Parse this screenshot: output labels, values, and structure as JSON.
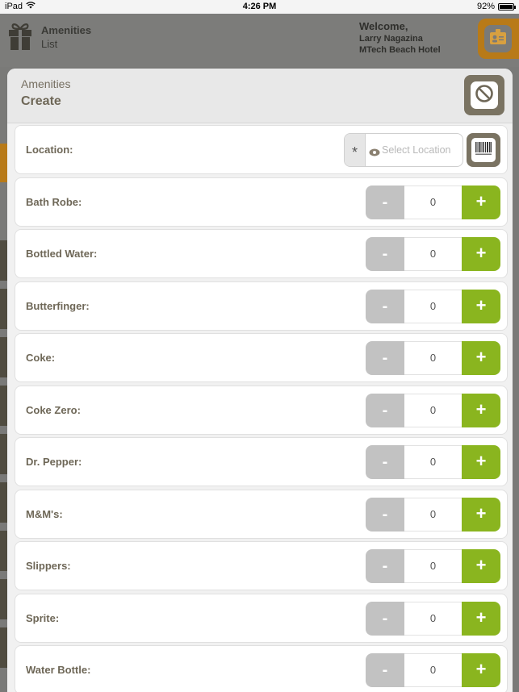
{
  "status": {
    "device": "iPad",
    "time": "4:26 PM",
    "battery": "92%",
    "battery_level": 0.92
  },
  "header": {
    "title": "Amenities",
    "subtitle": "List",
    "welcome": "Welcome,",
    "user": "Larry Nagazina",
    "hotel": "MTech Beach Hotel"
  },
  "modal": {
    "title": "Amenities",
    "subtitle": "Create",
    "location": {
      "label": "Location:",
      "required_mark": "*",
      "placeholder": "Select Location"
    },
    "items": [
      {
        "label": "Bath Robe:",
        "value": "0",
        "minus": "-",
        "plus": "+"
      },
      {
        "label": "Bottled Water:",
        "value": "0",
        "minus": "-",
        "plus": "+"
      },
      {
        "label": "Butterfinger:",
        "value": "0",
        "minus": "-",
        "plus": "+"
      },
      {
        "label": "Coke:",
        "value": "0",
        "minus": "-",
        "plus": "+"
      },
      {
        "label": "Coke Zero:",
        "value": "0",
        "minus": "-",
        "plus": "+"
      },
      {
        "label": "Dr. Pepper:",
        "value": "0",
        "minus": "-",
        "plus": "+"
      },
      {
        "label": "M&M's:",
        "value": "0",
        "minus": "-",
        "plus": "+"
      },
      {
        "label": "Slippers:",
        "value": "0",
        "minus": "-",
        "plus": "+"
      },
      {
        "label": "Sprite:",
        "value": "0",
        "minus": "-",
        "plus": "+"
      },
      {
        "label": "Water Bottle:",
        "value": "0",
        "minus": "-",
        "plus": "+"
      }
    ]
  },
  "colors": {
    "accent_orange": "#b87a18",
    "plus_green": "#8ab51f",
    "minus_gray": "#c2c2c2",
    "label_brown": "#6e6757"
  }
}
